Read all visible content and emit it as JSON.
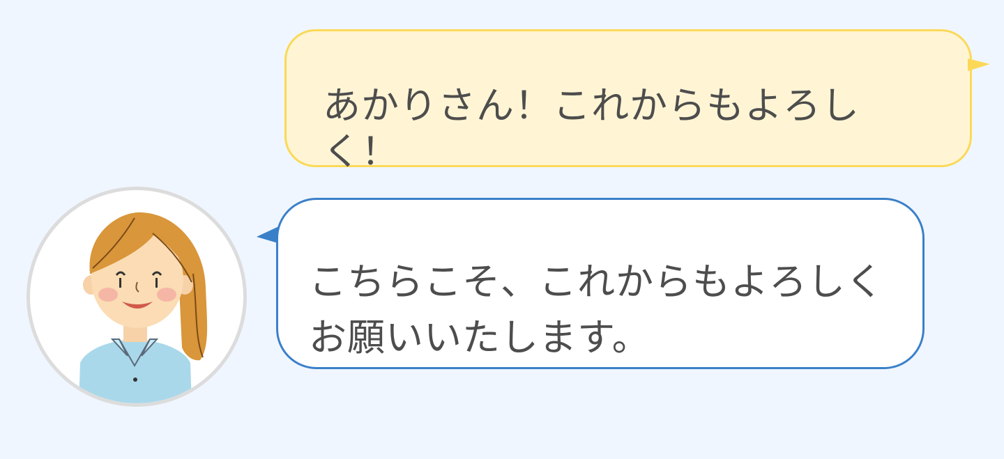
{
  "messages": [
    {
      "role": "user",
      "text": "あかりさん！これからもよろし\nく！"
    },
    {
      "role": "assistant",
      "text": "こちらこそ、これからもよろしく\nお願いいたします。"
    }
  ],
  "colors": {
    "background": "#f0f6ff",
    "user_bubble_fill": "#fff5d5",
    "user_bubble_border": "#fbd957",
    "assistant_bubble_fill": "#ffffff",
    "assistant_bubble_border": "#3a80c9",
    "text": "#4d4d4d"
  },
  "icons": {
    "avatar": "woman-avatar-icon"
  }
}
